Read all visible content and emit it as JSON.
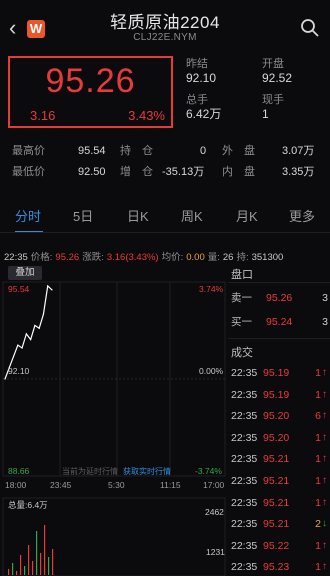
{
  "header": {
    "back_icon": "chevron-left-icon",
    "app_badge": "W",
    "title": "轻质原油2204",
    "subtitle": "CLJ22E.NYM"
  },
  "quote": {
    "last": "95.26",
    "change": "3.16",
    "percent": "3.43%"
  },
  "stats": {
    "prev_settle_label": "昨结",
    "prev_settle": "92.10",
    "open_label": "开盘",
    "open": "92.52",
    "volume_label": "总手",
    "volume": "6.42万",
    "current_vol_label": "现手",
    "current_vol": "1"
  },
  "detail": {
    "high_label": "最高价",
    "high": "95.54",
    "low_label": "最低价",
    "low": "92.50",
    "oi_label": "持　仓",
    "oi": "0",
    "oi_change_label": "增　仓",
    "oi_change": "-35.13万",
    "outer_label": "外　盘",
    "outer": "3.07万",
    "inner_label": "内　盘",
    "inner": "3.35万"
  },
  "tabs": [
    "分时",
    "5日",
    "日K",
    "周K",
    "月K",
    "更多"
  ],
  "infobar": {
    "time": "22:35",
    "price_label": "价格:",
    "price": "95.26",
    "change_label": "涨跌:",
    "change": "3.16(3.43%)",
    "avg_label": "均价:",
    "avg": "0.00",
    "vol_label": "量:",
    "vol": "26",
    "hold_label": "持:",
    "hold": "351300"
  },
  "chart": {
    "overlay_button": "叠加",
    "top_price": "95.54",
    "top_pct": "3.74%",
    "mid_price": "92.10",
    "mid_pct": "0.00%",
    "bottom_price": "88.66",
    "bottom_pct": "-3.74%",
    "delay_note": "当前为延时行情",
    "realtime_link": "获取实时行情",
    "time_ticks": [
      "18:00",
      "23:45",
      "5:30",
      "11:15",
      "17:00"
    ],
    "volume_label": "总量:6.4万",
    "vol_ticks": [
      "2462",
      "1231"
    ],
    "colors": {
      "price_line": "#ffffff",
      "up": "#e8393b",
      "down": "#2fa84f"
    }
  },
  "chart_data": {
    "type": "line",
    "title": "",
    "x": [
      "18:00",
      "18:30",
      "19:00",
      "19:30",
      "20:00",
      "20:30",
      "21:00",
      "21:30",
      "22:00",
      "22:15",
      "22:25",
      "22:35"
    ],
    "series": [
      {
        "values": [
          92.1,
          92.5,
          92.9,
          93.3,
          93.2,
          93.7,
          93.5,
          94.0,
          93.9,
          94.4,
          95.4,
          95.26
        ]
      }
    ],
    "ylim": [
      88.66,
      95.54
    ],
    "xlabel": "",
    "ylabel": ""
  },
  "book": {
    "title": "盘口",
    "rows": [
      {
        "label": "卖一",
        "price": "95.26",
        "qty": "3"
      },
      {
        "label": "买一",
        "price": "95.24",
        "qty": "3"
      }
    ],
    "trades_title": "成交",
    "trades": [
      {
        "time": "22:35",
        "price": "95.19",
        "qty": "1",
        "dir": "up"
      },
      {
        "time": "22:35",
        "price": "95.19",
        "qty": "1",
        "dir": "up"
      },
      {
        "time": "22:35",
        "price": "95.20",
        "qty": "6",
        "dir": "up"
      },
      {
        "time": "22:35",
        "price": "95.20",
        "qty": "1",
        "dir": "up"
      },
      {
        "time": "22:35",
        "price": "95.21",
        "qty": "1",
        "dir": "up"
      },
      {
        "time": "22:35",
        "price": "95.21",
        "qty": "1",
        "dir": "up"
      },
      {
        "time": "22:35",
        "price": "95.21",
        "qty": "1",
        "dir": "up"
      },
      {
        "time": "22:35",
        "price": "95.21",
        "qty": "2",
        "dir": "down"
      },
      {
        "time": "22:35",
        "price": "95.22",
        "qty": "1",
        "dir": "up"
      },
      {
        "time": "22:35",
        "price": "95.23",
        "qty": "1",
        "dir": "up"
      }
    ]
  }
}
